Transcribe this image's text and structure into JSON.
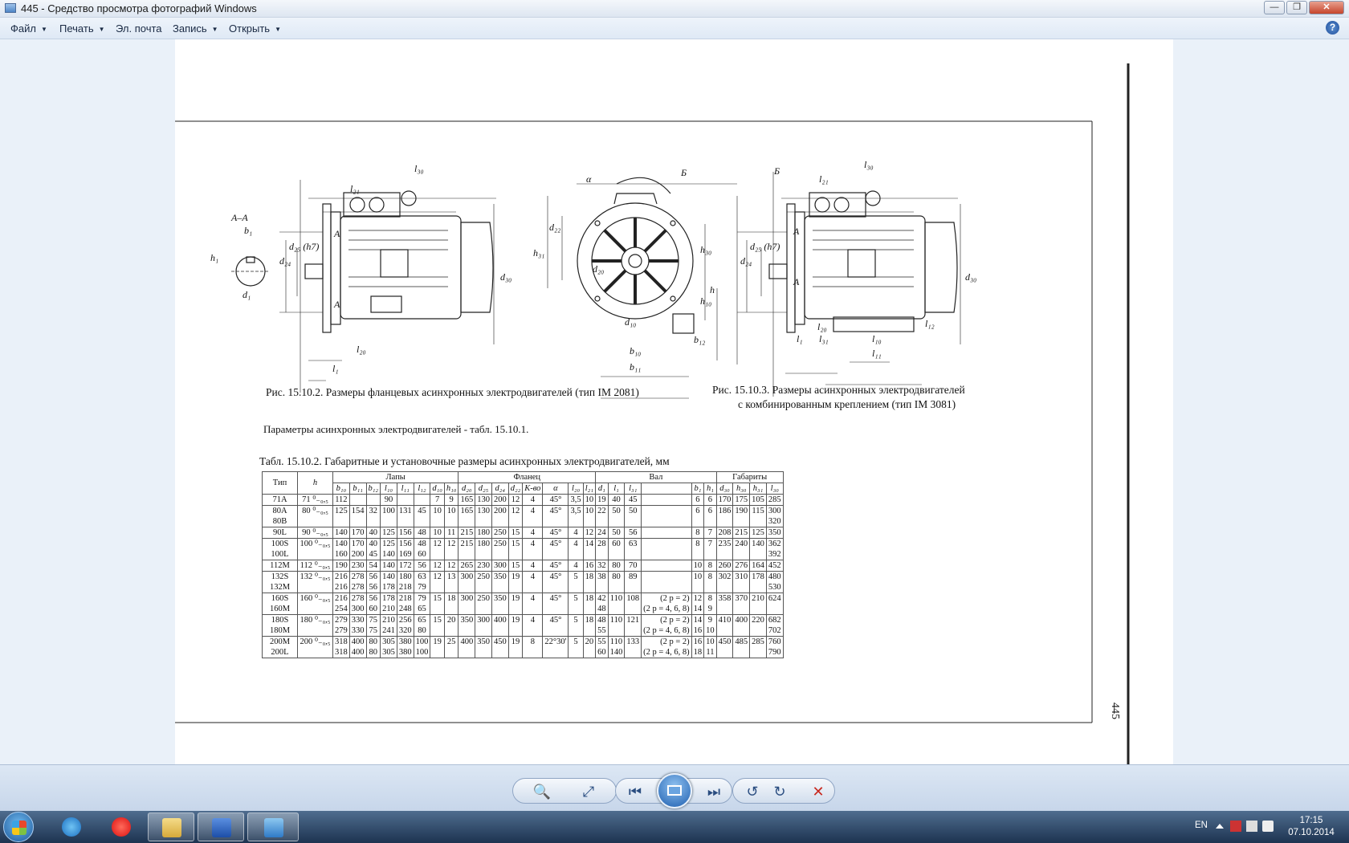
{
  "window": {
    "title": "445 - Средство просмотра фотографий Windows",
    "minimize": "—",
    "maximize": "❐",
    "close": "✕"
  },
  "menu": {
    "items": [
      "Файл",
      "Печать",
      "Эл. почта",
      "Запись",
      "Открыть"
    ],
    "help": "?"
  },
  "document": {
    "fig_labels": {
      "section": "А–А",
      "b1": "b₁",
      "h1": "h₁",
      "d1": "d₁",
      "l30": "l₃₀",
      "l21": "l₂₁",
      "d24": "d₂₄",
      "d25": "d₂₅ (h7)",
      "d30": "d₃₀",
      "A": "А",
      "l20": "l₂₀",
      "l1": "l₁",
      "B": "Б",
      "alpha": "α",
      "h31": "h₃₁",
      "d22": "d₂₂",
      "d20": "d₂₀",
      "h30": "h₃₀",
      "h": "h",
      "h10": "h₁₀",
      "d10": "d₁₀",
      "b12": "b₁₂",
      "b10": "b₁₀",
      "b11": "b₁₁",
      "l31": "l₃₁",
      "l10": "l₁₀",
      "l11": "l₁₁",
      "l12": "l₁₂"
    },
    "fig_15_10_2_caption": "Рис. 15.10.2.  Размеры фланцевых асинхронных электродвигателей (тип IM 2081)",
    "fig_15_10_3_caption_line1": "Рис. 15.10.3.  Размеры асинхронных электродвигателей",
    "fig_15_10_3_caption_line2": "с комбинированным креплением (тип IM 3081)",
    "params_note": "Параметры асинхронных электродвигателей - табл. 15.10.1.",
    "table_title": "Табл. 15.10.2.  Габаритные и установочные размеры асинхронных электродвигателей,  мм",
    "page_number": "445",
    "table": {
      "group_headers": [
        "Тип",
        "h",
        "Лапы",
        "Фланец",
        "Вал",
        "Габариты"
      ],
      "sub_headers": [
        "b₁₀",
        "b₁₁",
        "b₁₂",
        "l₁₀",
        "l₁₁",
        "l₁₂",
        "d₁₀",
        "h₁₀",
        "d₂₀",
        "d₂₅",
        "d₂₄",
        "d₂₂",
        "К-во",
        "α",
        "l₂₀",
        "l₂₁",
        "d₁",
        "l₁",
        "l₃₁",
        "",
        "b₁",
        "h₁",
        "d₃₀",
        "h₃₀",
        "h₃₁",
        "l₃₀"
      ],
      "rows": [
        [
          "71A",
          "71 ⁰₋₀,₅",
          "112",
          "",
          "",
          "90",
          "",
          "",
          "7",
          "9",
          "165",
          "130",
          "200",
          "12",
          "4",
          "45°",
          "3,5",
          "10",
          "19",
          "40",
          "45",
          "",
          "6",
          "6",
          "170",
          "175",
          "105",
          "285"
        ],
        [
          "80A\n80B",
          "80 ⁰₋₀,₅",
          "125",
          "154",
          "32",
          "100",
          "131",
          "45",
          "10",
          "10",
          "165",
          "130",
          "200",
          "12",
          "4",
          "45°",
          "3,5",
          "10",
          "22",
          "50",
          "50",
          "",
          "6",
          "6",
          "186",
          "190",
          "115",
          "300\n320"
        ],
        [
          "90L",
          "90 ⁰₋₀,₅",
          "140",
          "170",
          "40",
          "125",
          "156",
          "48",
          "10",
          "11",
          "215",
          "180",
          "250",
          "15",
          "4",
          "45°",
          "4",
          "12",
          "24",
          "50",
          "56",
          "",
          "8",
          "7",
          "208",
          "215",
          "125",
          "350"
        ],
        [
          "100S\n100L",
          "100 ⁰₋₀,₅",
          "140\n160",
          "170\n200",
          "40\n45",
          "125\n140",
          "156\n169",
          "48\n60",
          "12",
          "12",
          "215",
          "180",
          "250",
          "15",
          "4",
          "45°",
          "4",
          "14",
          "28",
          "60",
          "63",
          "",
          "8",
          "7",
          "235",
          "240",
          "140",
          "362\n392"
        ],
        [
          "112M",
          "112 ⁰₋₀,₅",
          "190",
          "230",
          "54",
          "140",
          "172",
          "56",
          "12",
          "12",
          "265",
          "230",
          "300",
          "15",
          "4",
          "45°",
          "4",
          "16",
          "32",
          "80",
          "70",
          "",
          "10",
          "8",
          "260",
          "276",
          "164",
          "452"
        ],
        [
          "132S\n132M",
          "132 ⁰₋₀,₅",
          "216\n216",
          "278\n278",
          "56\n56",
          "140\n178",
          "180\n218",
          "63\n79",
          "12",
          "13",
          "300",
          "250",
          "350",
          "19",
          "4",
          "45°",
          "5",
          "18",
          "38",
          "80",
          "89",
          "",
          "10",
          "8",
          "302",
          "310",
          "178",
          "480\n530"
        ],
        [
          "160S\n160M",
          "160 ⁰₋₀,₅",
          "216\n254",
          "278\n300",
          "56\n60",
          "178\n210",
          "218\n248",
          "79\n65",
          "15",
          "18",
          "300",
          "250",
          "350",
          "19",
          "4",
          "45°",
          "5",
          "18",
          "42\n48",
          "110",
          "108",
          "(2 p = 2)\n(2 p = 4, 6, 8)",
          "12\n14",
          "8\n9",
          "358",
          "370",
          "210",
          "624"
        ],
        [
          "180S\n180M",
          "180 ⁰₋₀,₅",
          "279\n279",
          "330\n330",
          "75\n75",
          "210\n241",
          "256\n320",
          "65\n80",
          "15",
          "20",
          "350",
          "300",
          "400",
          "19",
          "4",
          "45°",
          "5",
          "18",
          "48\n55",
          "110",
          "121",
          "(2 p = 2)\n(2 p = 4, 6, 8)",
          "14\n16",
          "9\n10",
          "410",
          "400",
          "220",
          "682\n702"
        ],
        [
          "200M\n200L",
          "200 ⁰₋₀,₅",
          "318\n318",
          "400\n400",
          "80\n80",
          "305\n305",
          "380\n380",
          "100\n100",
          "19",
          "25",
          "400",
          "350",
          "450",
          "19",
          "8",
          "22°30'",
          "5",
          "20",
          "55\n60",
          "110\n140",
          "133",
          "(2 p = 2)\n(2 p = 4, 6, 8)",
          "16\n18",
          "10\n11",
          "450",
          "485",
          "285",
          "760\n790"
        ]
      ]
    }
  },
  "toolbar": {
    "zoom": "🔍",
    "fit": "⤢",
    "prev": "⏮",
    "next": "⏭",
    "rotate_ccw": "↺",
    "rotate_cw": "↻",
    "delete": "✕"
  },
  "taskbar": {
    "lang": "EN",
    "time": "17:15",
    "date": "07.10.2014"
  }
}
